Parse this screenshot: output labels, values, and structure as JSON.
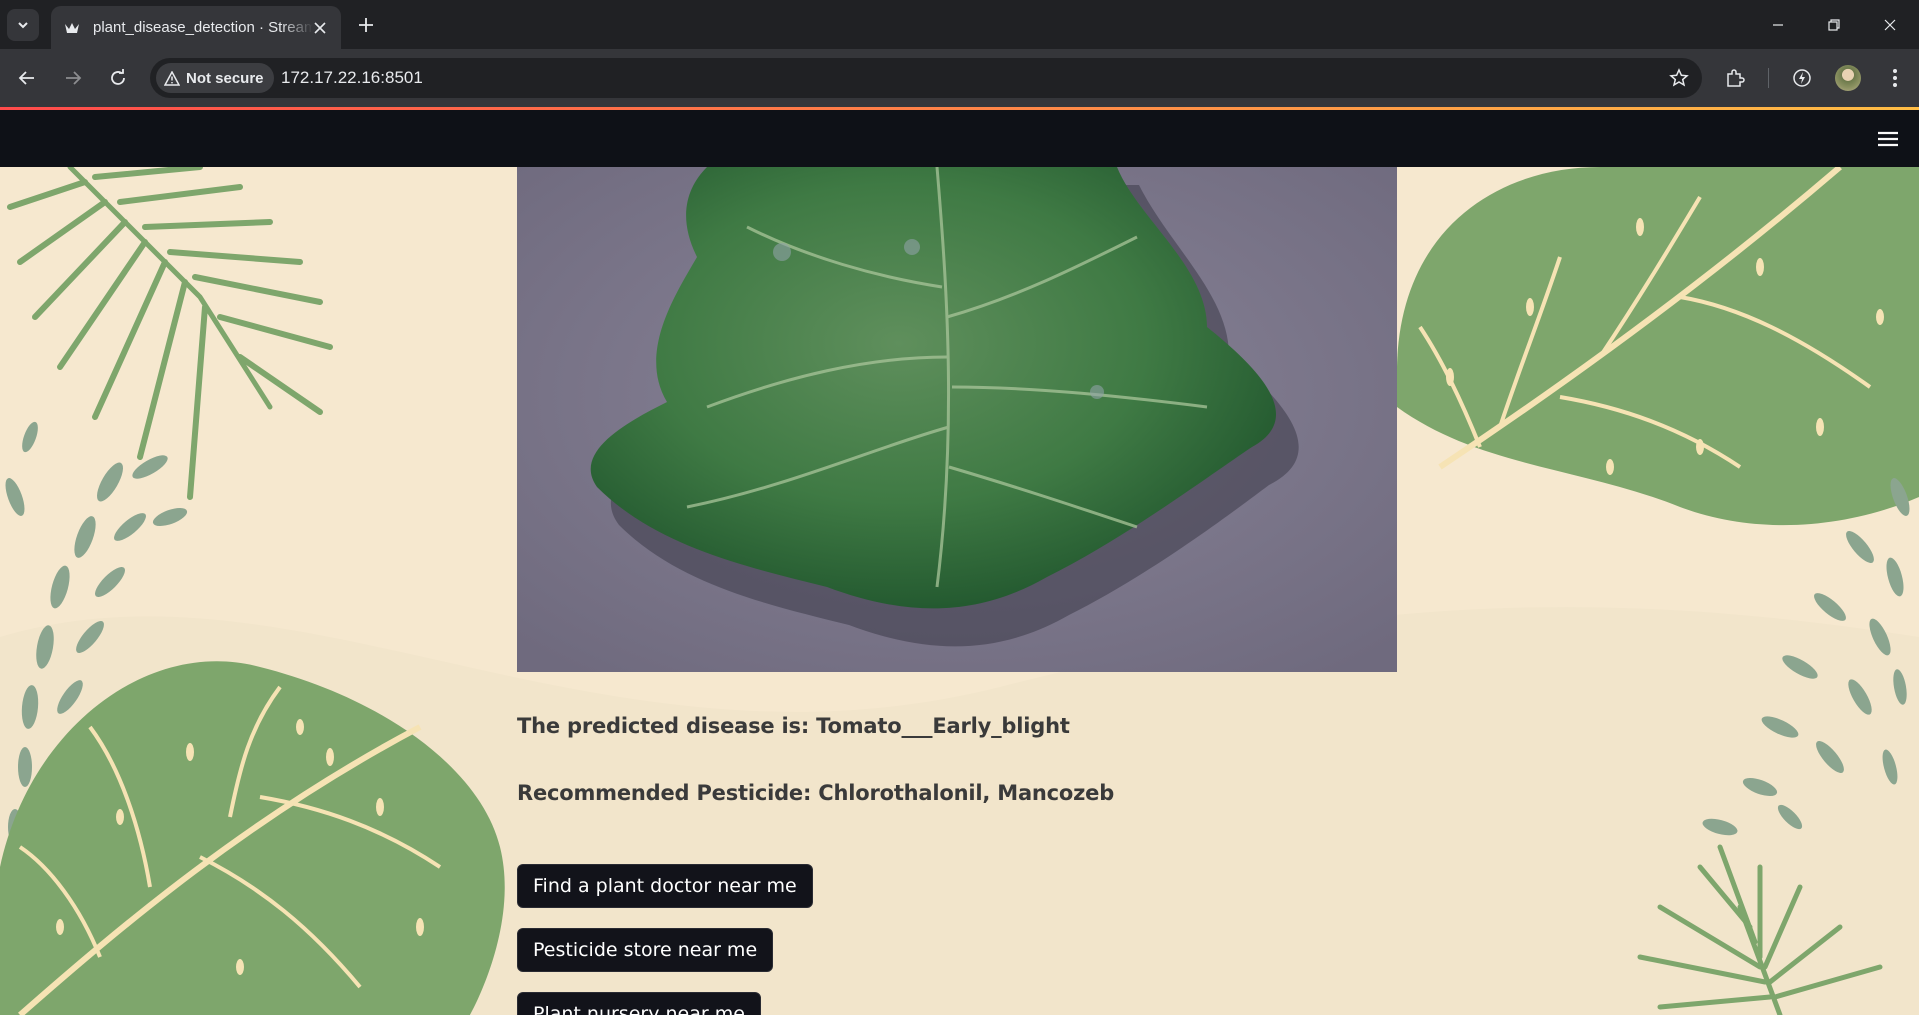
{
  "browser": {
    "tab_title": "plant_disease_detection · Streamlit",
    "security_label": "Not secure",
    "url": "172.17.22.16:8501"
  },
  "app": {
    "image_alt": "uploaded tomato leaf image",
    "prediction_text": "The predicted disease is: Tomato___Early_blight",
    "pesticide_text": "Recommended Pesticide: Chlorothalonil, Mancozeb",
    "buttons": [
      {
        "label": "Find a plant doctor near me"
      },
      {
        "label": "Pesticide store near me"
      },
      {
        "label": "Plant nursery near me"
      }
    ]
  },
  "colors": {
    "background": "#f6e8cf",
    "leaf_green": "#7ea66c",
    "header": "#0e1117",
    "button": "#12131a"
  }
}
